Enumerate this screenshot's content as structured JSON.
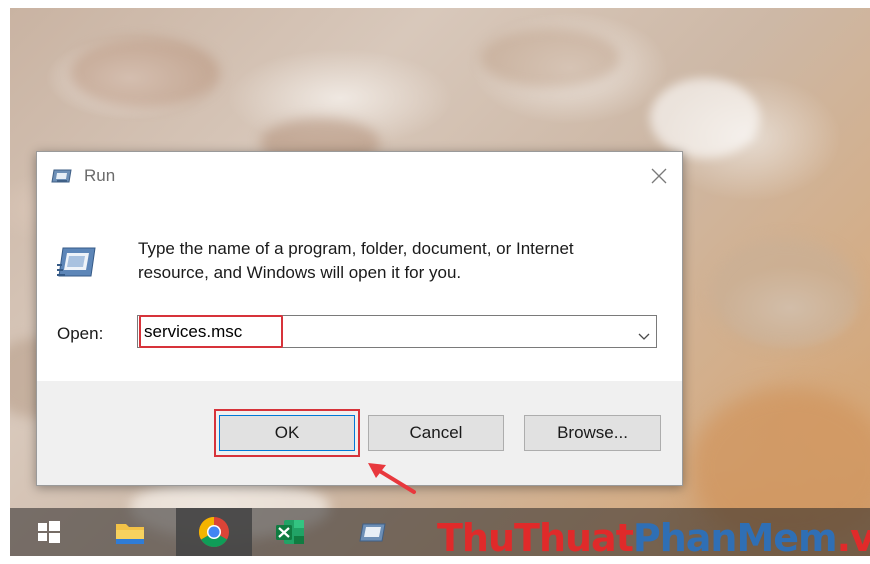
{
  "dialog": {
    "title": "Run",
    "description_line1": "Type the name of a program, folder, document, or Internet",
    "description_line2": "resource, and Windows will open it for you.",
    "open_label": "Open:",
    "open_value": "services.msc",
    "ok_label": "OK",
    "cancel_label": "Cancel",
    "browse_label": "Browse..."
  },
  "taskbar": {
    "items": [
      "windows-start-icon",
      "file-explorer-icon",
      "chrome-icon",
      "excel-icon",
      "run-icon"
    ]
  },
  "watermark": {
    "part1": "ThuThuat",
    "part2": "PhanMem",
    "part3": ".vn"
  },
  "colors": {
    "highlight": "#d7333a",
    "watermark_red": "#e02a2a",
    "watermark_blue": "#2f6fb5"
  }
}
